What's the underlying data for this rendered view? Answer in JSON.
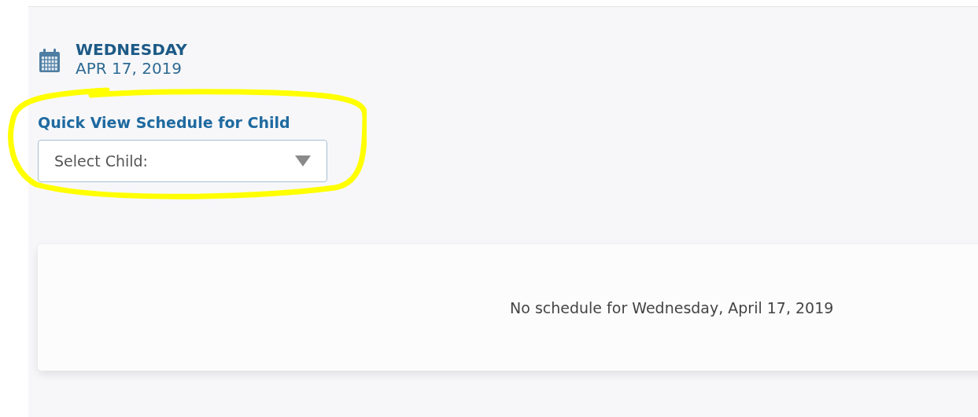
{
  "date_header": {
    "weekday": "WEDNESDAY",
    "date": "APR 17, 2019"
  },
  "quick_view": {
    "label": "Quick View Schedule for Child",
    "select": {
      "placeholder": "Select Child:"
    },
    "highlighted": true
  },
  "schedule_card": {
    "message": "No schedule for Wednesday, April 17, 2019"
  }
}
